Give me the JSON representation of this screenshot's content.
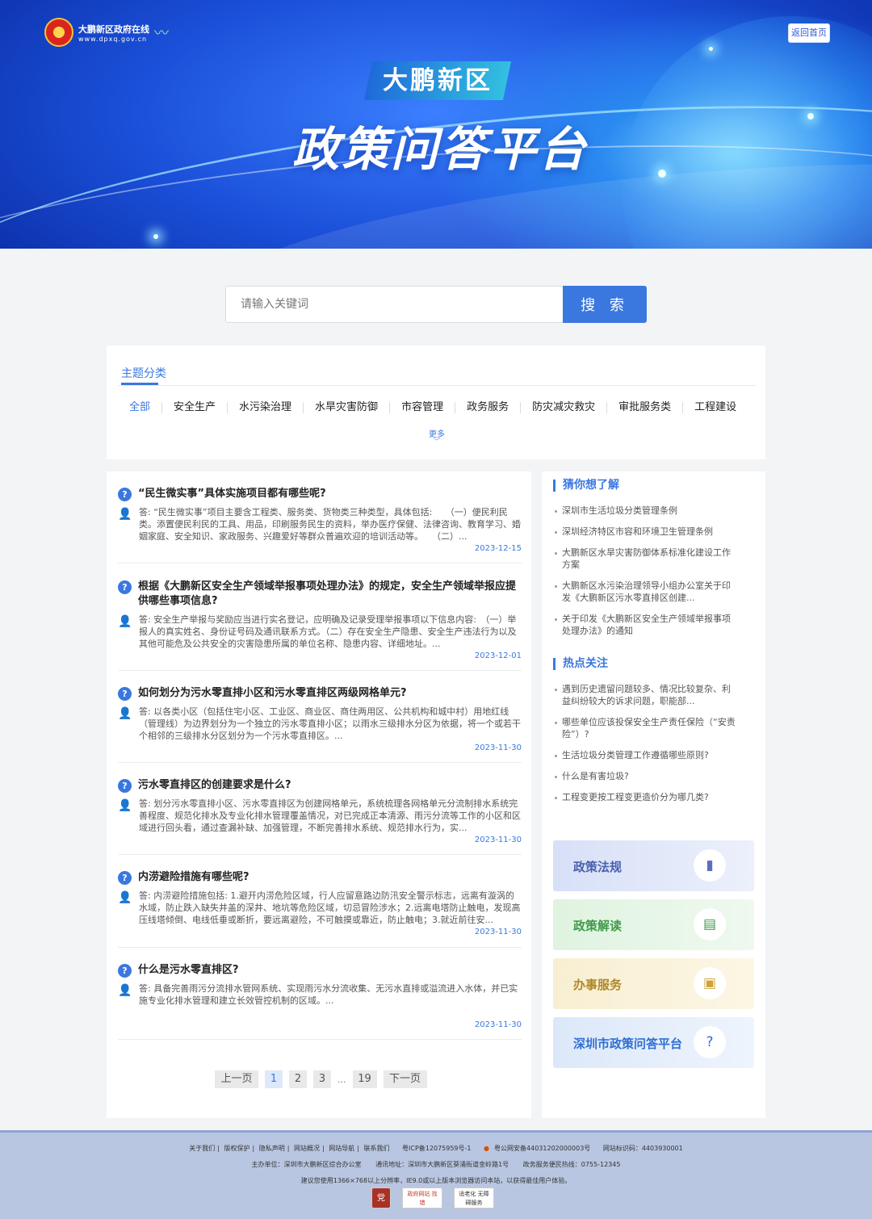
{
  "header": {
    "site_name_cn": "大鹏新区政府在线",
    "site_name_url": "www.dpxq.gov.cn",
    "home_button": "返回首页",
    "title_small": "大鹏新区",
    "title_big": "政策问答平台"
  },
  "search": {
    "placeholder": "请输入关键词",
    "button": "搜 索"
  },
  "topics": {
    "heading": "主题分类",
    "categories": [
      "全部",
      "安全生产",
      "水污染治理",
      "水旱灾害防御",
      "市容管理",
      "政务服务",
      "防灾减灾救灾",
      "审批服务类",
      "工程建设"
    ],
    "more": "更多"
  },
  "qa_list": [
    {
      "question": "“民生微实事”具体实施项目都有哪些呢?",
      "answer": "答: “民生微实事”项目主要含工程类、服务类、货物类三种类型，具体包括:　　（一）便民利民类。添置便民利民的工具、用品，印刷服务民生的资料，举办医疗保健、法律咨询、教育学习、婚姻家庭、安全知识、家政服务、兴趣爱好等群众普遍欢迎的培训活动等。　　（二）...",
      "date": "2023-12-15"
    },
    {
      "question": "根据《大鹏新区安全生产领域举报事项处理办法》的规定，安全生产领域举报应提供哪些事项信息?",
      "answer": "答: 安全生产举报与奖励应当进行实名登记，应明确及记录受理举报事项以下信息内容:　（一）举报人的真实姓名、身份证号码及通讯联系方式。（二）存在安全生产隐患、安全生产违法行为以及其他可能危及公共安全的灾害隐患所属的单位名称、隐患内容、详细地址。...",
      "date": "2023-12-01"
    },
    {
      "question": "如何划分为污水零直排小区和污水零直排区两级网格单元?",
      "answer": "答: 以各类小区（包括住宅小区、工业区、商业区、商住两用区、公共机构和城中村）用地红线（管理线）为边界划分为一个独立的污水零直排小区；以雨水三级排水分区为依据，将一个或若干个相邻的三级排水分区划分为一个污水零直排区。...",
      "date": "2023-11-30"
    },
    {
      "question": "污水零直排区的创建要求是什么?",
      "answer": "答: 划分污水零直排小区、污水零直排区为创建网格单元，系统梳理各网格单元分流制排水系统完善程度、规范化排水及专业化排水管理覆盖情况，对已完成正本清源、雨污分流等工作的小区和区域进行回头看，通过查漏补缺、加强管理，不断完善排水系统、规范排水行为，实...",
      "date": "2023-11-30"
    },
    {
      "question": "内涝避险措施有哪些呢?",
      "answer": "答: 内涝避险措施包括: 1.避开内涝危险区域，行人应留意路边防汛安全警示标志，远离有漩涡的水域，防止跌入缺失井盖的深井、地坑等危险区域，切忌冒险涉水；2.远离电塔防止触电，发现高压线塔倾倒、电线低垂或断折，要远离避险，不可触摸或靠近，防止触电；3.就近前往安...",
      "date": "2023-11-30"
    },
    {
      "question": "什么是污水零直排区?",
      "answer": "答: 具备完善雨污分流排水管网系统、实现雨污水分流收集、无污水直排或溢流进入水体，并已实施专业化排水管理和建立长效管控机制的区域。...",
      "date": "2023-11-30"
    }
  ],
  "pagination": {
    "prev": "上一页",
    "pages": [
      "1",
      "2",
      "3"
    ],
    "dots": "...",
    "last": "19",
    "next": "下一页",
    "current": "1"
  },
  "sidebar": {
    "guess_heading": "猜你想了解",
    "guess_items": [
      "深圳市生活垃圾分类管理条例",
      "深圳经济特区市容和环境卫生管理条例",
      "大鹏新区水旱灾害防御体系标准化建设工作方案",
      "大鹏新区水污染治理领导小组办公室关于印发《大鹏新区污水零直排区创建...",
      "关于印发《大鹏新区安全生产领域举报事项处理办法》的通知"
    ],
    "hot_heading": "热点关注",
    "hot_items": [
      "遇到历史遗留问题较多、情况比较复杂、利益纠纷较大的诉求问题，职能部...",
      "哪些单位应该投保安全生产责任保险（“安责险”）?",
      "生活垃圾分类管理工作遵循哪些原则?",
      "什么是有害垃圾?",
      "工程变更按工程变更造价分为哪几类?"
    ],
    "cards": [
      {
        "label": "政策法规",
        "icon": "book-icon"
      },
      {
        "label": "政策解读",
        "icon": "document-icon"
      },
      {
        "label": "办事服务",
        "icon": "service-icon"
      },
      {
        "label": "深圳市政策问答平台",
        "icon": "question-bubble-icon"
      }
    ]
  },
  "footer": {
    "links": [
      "关于我们",
      "版权保护",
      "隐私声明",
      "网站概况",
      "网站导航",
      "联系我们"
    ],
    "icp": "粤ICP备12075959号-1",
    "police": "粤公网安备44031202000003号",
    "site_id": "网站标识码：4403930001",
    "sponsor": "主办单位：深圳市大鹏新区综合办公室",
    "address": "通讯地址：深圳市大鹏新区葵涌街道金岭路1号",
    "hotline": "政务服务便民热线：0755-12345",
    "note": "建议您使用1366×768以上分辨率，IE9.0或以上版本浏览器访问本站，以获得最佳用户体验。",
    "badge1": "党",
    "badge2": "政府网站 找错",
    "badge3": "适老化 无障碍服务"
  }
}
